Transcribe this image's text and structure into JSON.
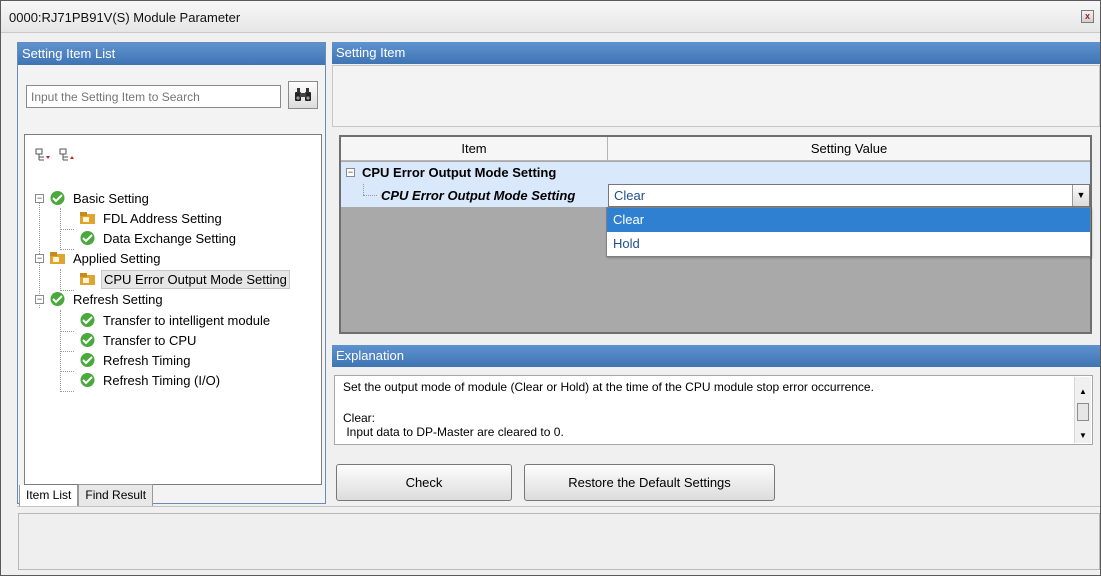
{
  "window": {
    "title": "0000:RJ71PB91V(S) Module Parameter",
    "close_glyph": "x"
  },
  "setting_item_list": {
    "header": "Setting Item List",
    "search_placeholder": "Input the Setting Item to Search",
    "search_button_icon": "binoculars-icon",
    "toolbar_icons": [
      "expand-all-icon",
      "collapse-all-icon"
    ],
    "tree": [
      {
        "label": "Basic Setting",
        "level": 0,
        "icon": "check-icon",
        "expanded": true
      },
      {
        "label": "FDL Address Setting",
        "level": 1,
        "icon": "folder-icon"
      },
      {
        "label": "Data Exchange Setting",
        "level": 1,
        "icon": "check-icon"
      },
      {
        "label": "Applied Setting",
        "level": 0,
        "icon": "folder-icon",
        "expanded": true
      },
      {
        "label": "CPU Error Output Mode Setting",
        "level": 1,
        "icon": "folder-icon",
        "selected": true
      },
      {
        "label": "Refresh Setting",
        "level": 0,
        "icon": "check-icon",
        "expanded": true
      },
      {
        "label": "Transfer to intelligent module",
        "level": 1,
        "icon": "check-icon"
      },
      {
        "label": "Transfer to CPU",
        "level": 1,
        "icon": "check-icon"
      },
      {
        "label": "Refresh Timing",
        "level": 1,
        "icon": "check-icon"
      },
      {
        "label": "Refresh Timing (I/O)",
        "level": 1,
        "icon": "check-icon"
      }
    ],
    "tabs": [
      "Item List",
      "Find Result"
    ]
  },
  "setting_item": {
    "header": "Setting Item",
    "columns": {
      "item": "Item",
      "value": "Setting Value"
    },
    "group_label": "CPU Error Output Mode Setting",
    "row_label": "CPU Error Output Mode Setting",
    "row_value": "Clear",
    "dropdown_options": [
      "Clear",
      "Hold"
    ],
    "highlighted_option": "Clear"
  },
  "explanation": {
    "header": "Explanation",
    "line1": "Set the output mode of module (Clear or Hold) at the time of the CPU module stop error occurrence.",
    "line2": "Clear:",
    "line3": " Input data to DP-Master are cleared to 0."
  },
  "buttons": {
    "check": "Check",
    "restore": "Restore the Default Settings"
  },
  "colors": {
    "header_blue": "#3f74b4",
    "selection_blue": "#2f80d0",
    "row_blue": "#d9e8fa"
  }
}
